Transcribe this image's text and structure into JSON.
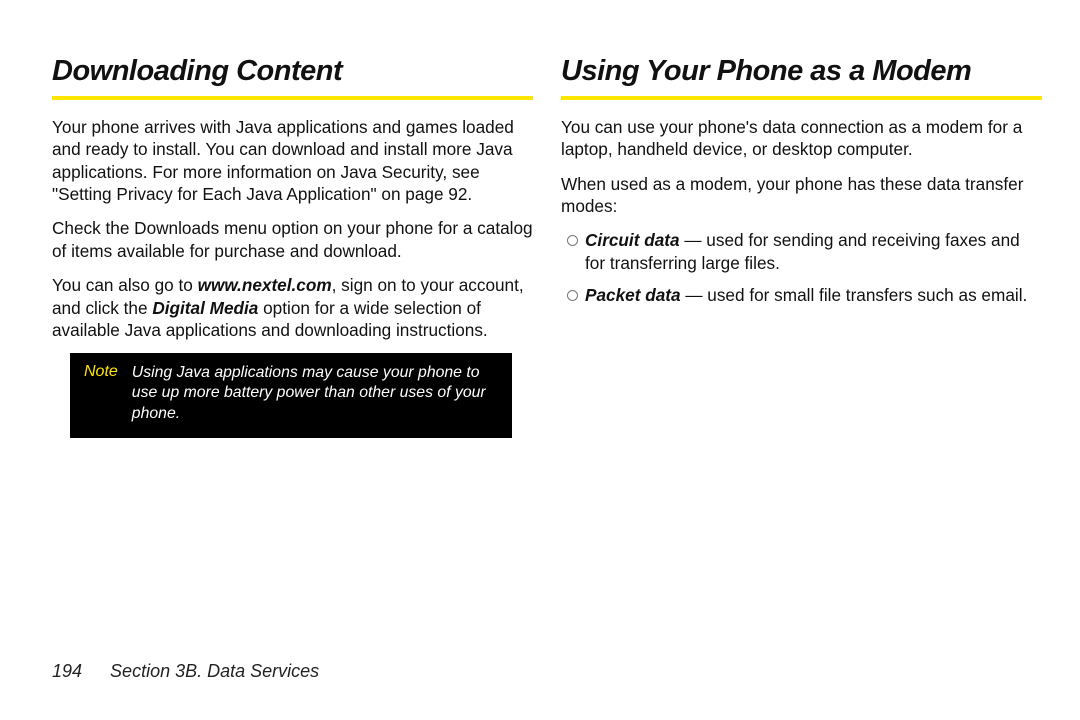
{
  "left": {
    "heading": "Downloading Content",
    "p1a": "Your phone arrives with Java applications and games loaded and ready to install. You can download and install more Java applications. For more information on Java Security, see \"Setting Privacy for Each Java Application\" on page 92.",
    "p2": "Check the Downloads menu option on your phone for a catalog of items available for purchase and download.",
    "p3_pre": "You can also go to ",
    "p3_url": "www.nextel.com",
    "p3_mid": ", sign on to your account, and click the ",
    "p3_opt": "Digital Media",
    "p3_post": " option for a wide selection of available Java applications and downloading instructions.",
    "note_label": "Note",
    "note_text": "Using Java applications may cause your phone to use up more battery power than other uses of your phone."
  },
  "right": {
    "heading": "Using Your Phone as a Modem",
    "p1": "You can use your phone's data connection as a modem for a laptop, handheld device, or desktop computer.",
    "p2": "When used as a modem, your phone has these data transfer modes:",
    "b1_term": "Circuit data",
    "b1_rest": " — used for sending and receiving faxes and for transferring large files.",
    "b2_term": "Packet data",
    "b2_rest": " — used for small file transfers such as email."
  },
  "footer": {
    "page": "194",
    "section": "Section 3B. Data Services"
  }
}
